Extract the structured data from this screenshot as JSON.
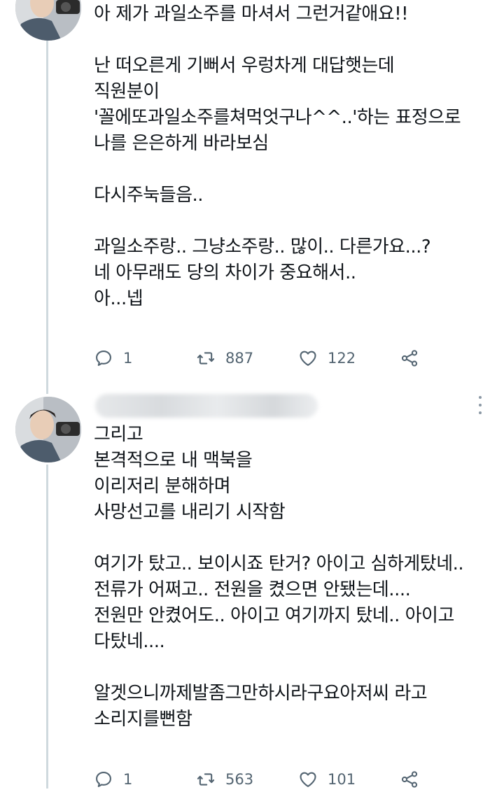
{
  "tweet1": {
    "lines": [
      "아 제가 과일소주를 마셔서 그런거같애요!!",
      "",
      "난 떠오른게 기뻐서 우렁차게 대답햇는데",
      "직원분이",
      "'꼴에또과일소주를쳐먹엇구나^^..'하는 표정으로",
      "나를 은은하게 바라보심",
      "",
      "다시주눅들음..",
      "",
      "과일소주랑.. 그냥소주랑.. 많이.. 다른가요...?",
      "네 아무래도 당의 차이가 중요해서..",
      "아...넵"
    ],
    "reply_count": "1",
    "retweet_count": "887",
    "like_count": "122"
  },
  "tweet2": {
    "lines": [
      "그리고",
      "본격적으로 내 맥북을",
      "이리저리 분해하며",
      "사망선고를 내리기 시작함",
      "",
      "여기가 탔고.. 보이시죠 탄거? 아이고 심하게탔네..",
      "전류가 어쩌고.. 전원을 켰으면 안됐는데....",
      "전원만 안켰어도.. 아이고 여기까지 탔네.. 아이고",
      "다탔네....",
      "",
      "알겟으니까제발좀그만하시라구요아저씨 라고",
      "소리지를뻔함"
    ],
    "reply_count": "1",
    "retweet_count": "563",
    "like_count": "101"
  },
  "icons": {
    "reply": "reply-icon",
    "retweet": "retweet-icon",
    "like": "heart-icon",
    "share": "share-icon",
    "more": "more-vertical-icon"
  },
  "colors": {
    "text": "#0f1419",
    "secondary": "#536471",
    "thread_line": "#cfd9de"
  }
}
